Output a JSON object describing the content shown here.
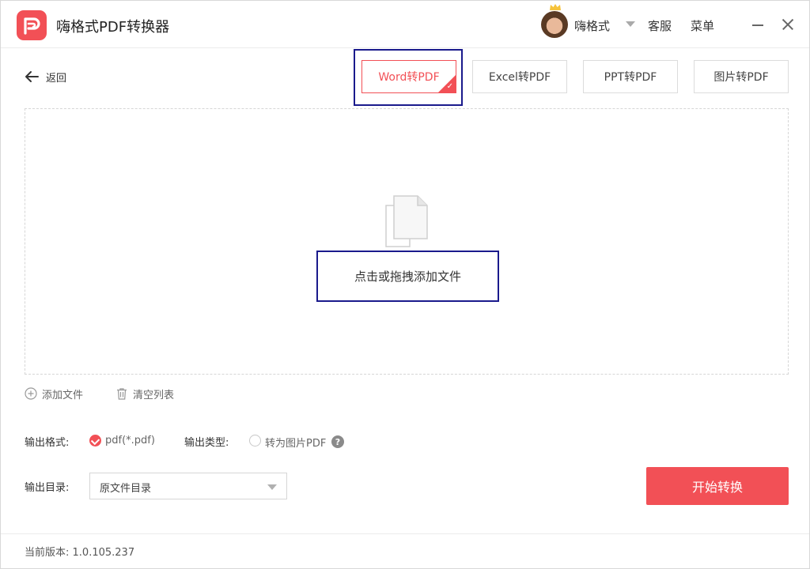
{
  "app": {
    "title": "嗨格式PDF转换器",
    "accent_color": "#f25056",
    "logo_icon": "pdf-logo-icon"
  },
  "header": {
    "user_name": "嗨格式",
    "support_label": "客服",
    "menu_label": "菜单",
    "avatar_icon": "user-avatar",
    "crown_icon": "vip-crown-icon"
  },
  "nav": {
    "back_label": "返回",
    "tabs": [
      {
        "label": "Word转PDF",
        "active": true
      },
      {
        "label": "Excel转PDF",
        "active": false
      },
      {
        "label": "PPT转PDF",
        "active": false
      },
      {
        "label": "图片转PDF",
        "active": false
      }
    ]
  },
  "drop_zone": {
    "label": "点击或拖拽添加文件",
    "icon": "file-copy-icon"
  },
  "actions": {
    "add_file": "添加文件",
    "clear_list": "清空列表"
  },
  "options": {
    "format_label": "输出格式:",
    "format_value": "pdf(*.pdf)",
    "type_label": "输出类型:",
    "type_value": "转为图片PDF",
    "type_help": "?",
    "dir_label": "输出目录:",
    "dir_value": "原文件目录"
  },
  "start_button": "开始转换",
  "footer": {
    "version_label": "当前版本:",
    "version": "1.0.105.237"
  }
}
